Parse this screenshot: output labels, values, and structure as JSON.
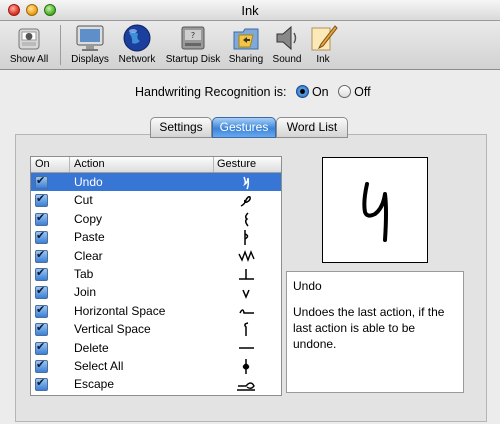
{
  "window": {
    "title": "Ink"
  },
  "toolbar": {
    "items": [
      {
        "label": "Show All",
        "icon": "apple-switch-icon"
      },
      {
        "label": "Displays",
        "icon": "monitor-icon"
      },
      {
        "label": "Network",
        "icon": "globe-icon"
      },
      {
        "label": "Startup Disk",
        "icon": "disk-icon"
      },
      {
        "label": "Sharing",
        "icon": "sharing-folder-icon"
      },
      {
        "label": "Sound",
        "icon": "speaker-icon"
      },
      {
        "label": "Ink",
        "icon": "ink-pen-icon"
      }
    ]
  },
  "recognition": {
    "label": "Handwriting Recognition is:",
    "on_label": "On",
    "off_label": "Off",
    "selected": "On"
  },
  "tabs": {
    "items": [
      "Settings",
      "Gestures",
      "Word List"
    ],
    "selected": "Gestures"
  },
  "table": {
    "headers": {
      "on": "On",
      "action": "Action",
      "gesture": "Gesture"
    },
    "rows": [
      {
        "on": true,
        "action": "Undo"
      },
      {
        "on": true,
        "action": "Cut"
      },
      {
        "on": true,
        "action": "Copy"
      },
      {
        "on": true,
        "action": "Paste"
      },
      {
        "on": true,
        "action": "Clear"
      },
      {
        "on": true,
        "action": "Tab"
      },
      {
        "on": true,
        "action": "Join"
      },
      {
        "on": true,
        "action": "Horizontal Space"
      },
      {
        "on": true,
        "action": "Vertical Space"
      },
      {
        "on": true,
        "action": "Delete"
      },
      {
        "on": true,
        "action": "Select All"
      },
      {
        "on": true,
        "action": "Escape"
      }
    ],
    "selected_row": "Undo"
  },
  "detail": {
    "title": "Undo",
    "description": "Undoes the last action, if the last action is able to be undone."
  },
  "colors": {
    "selection": "#3876d6",
    "tab_selected": "#3c84d8"
  }
}
